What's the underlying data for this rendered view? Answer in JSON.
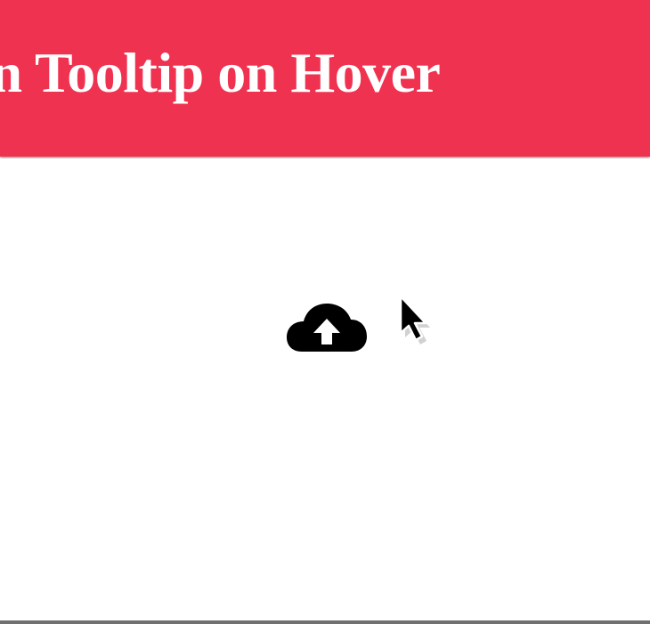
{
  "header": {
    "title": "gn Tooltip on Hover",
    "background_color": "#f03251",
    "text_color": "#ffffff"
  },
  "main": {
    "upload_icon": "cloud-upload-icon",
    "cursor_icon": "mouse-pointer-icon"
  }
}
